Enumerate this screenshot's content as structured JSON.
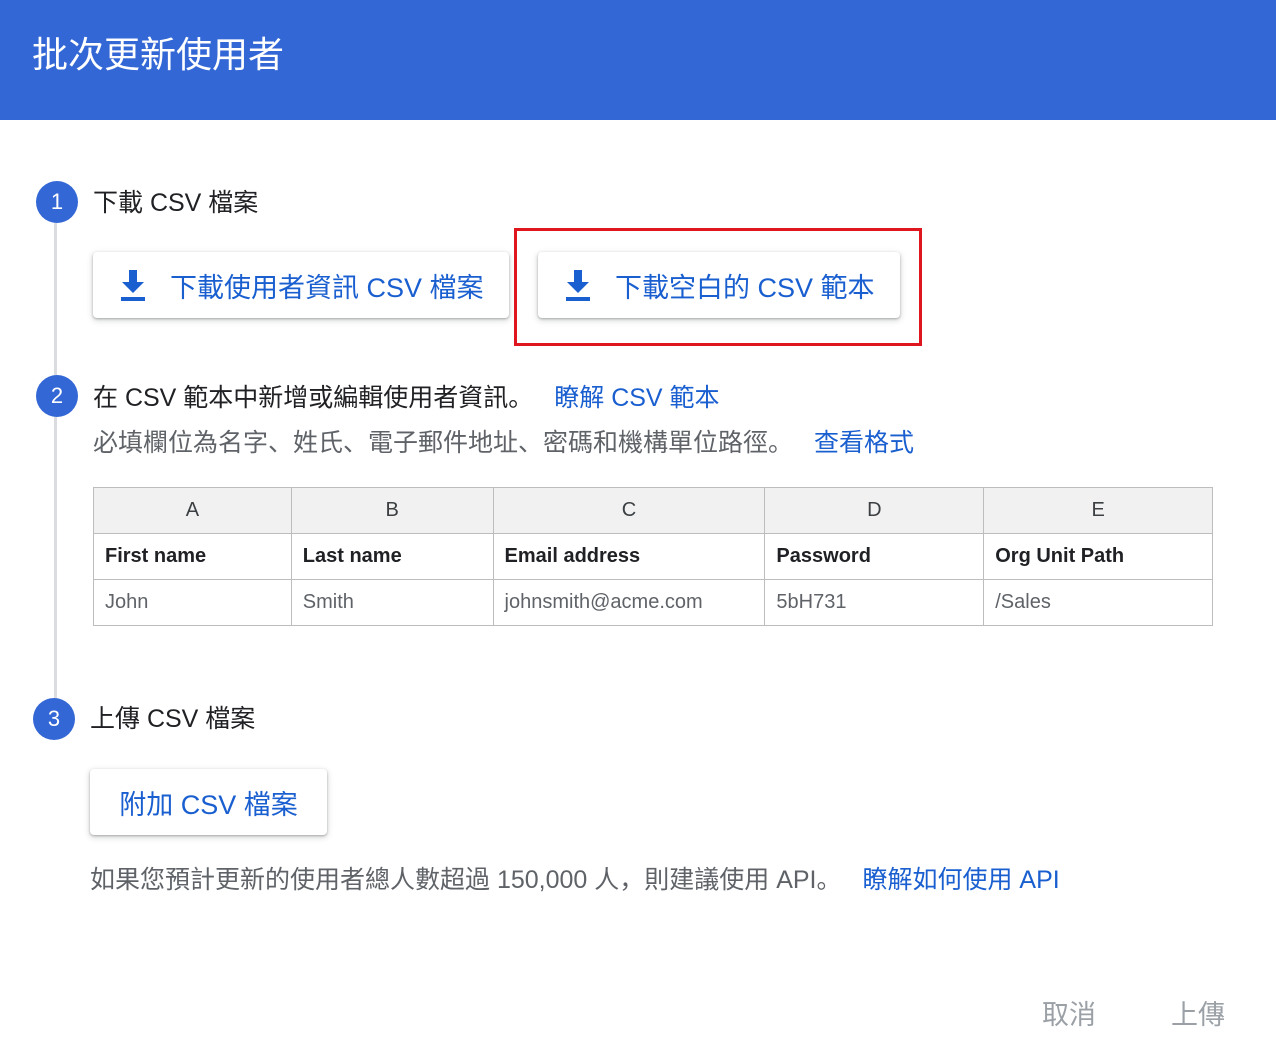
{
  "header": {
    "title": "批次更新使用者"
  },
  "step1": {
    "number": "1",
    "title": "下載 CSV 檔案",
    "download_user_info_label": "下載使用者資訊 CSV 檔案",
    "download_blank_template_label": "下載空白的 CSV 範本",
    "icon": "download-icon"
  },
  "step2": {
    "number": "2",
    "title": "在 CSV 範本中新增或編輯使用者資訊。",
    "learn_link": "瞭解 CSV 範本",
    "required_text": "必填欄位為名字、姓氏、電子郵件地址、密碼和機構單位路徑。",
    "view_format_link": "查看格式",
    "table": {
      "columns": [
        "A",
        "B",
        "C",
        "D",
        "E"
      ],
      "fields": [
        "First name",
        "Last name",
        "Email address",
        "Password",
        "Org Unit Path"
      ],
      "example": [
        "John",
        "Smith",
        "johnsmith@acme.com",
        "5bH731",
        "/Sales"
      ]
    }
  },
  "step3": {
    "number": "3",
    "title": "上傳 CSV 檔案",
    "attach_label": "附加 CSV 檔案",
    "api_note": "如果您預計更新的使用者總人數超過 150,000 人，則建議使用 API。",
    "api_link": "瞭解如何使用 API"
  },
  "footer": {
    "cancel_label": "取消",
    "upload_label": "上傳"
  },
  "colors": {
    "accent": "#3367d6",
    "link": "#1a5fd0",
    "highlight": "#e0161e"
  }
}
